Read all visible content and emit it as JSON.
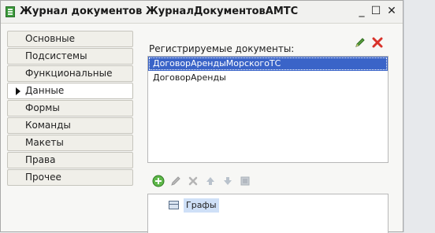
{
  "window": {
    "title": "Журнал документов ЖурналДокументовАМТС"
  },
  "tabs": [
    {
      "label": "Основные"
    },
    {
      "label": "Подсистемы"
    },
    {
      "label": "Функциональные опции"
    },
    {
      "label": "Данные",
      "active": true
    },
    {
      "label": "Формы"
    },
    {
      "label": "Команды"
    },
    {
      "label": "Макеты"
    },
    {
      "label": "Права"
    },
    {
      "label": "Прочее"
    }
  ],
  "registered": {
    "label": "Регистрируемые документы:",
    "items": [
      "ДоговорАрендыМорскогоТС",
      "ДоговорАренды"
    ],
    "selected_index": 0
  },
  "columns_tree": {
    "items": [
      "Графы"
    ]
  },
  "colors": {
    "accent": "#3a64c8",
    "tab_bg": "#f0efe9"
  }
}
